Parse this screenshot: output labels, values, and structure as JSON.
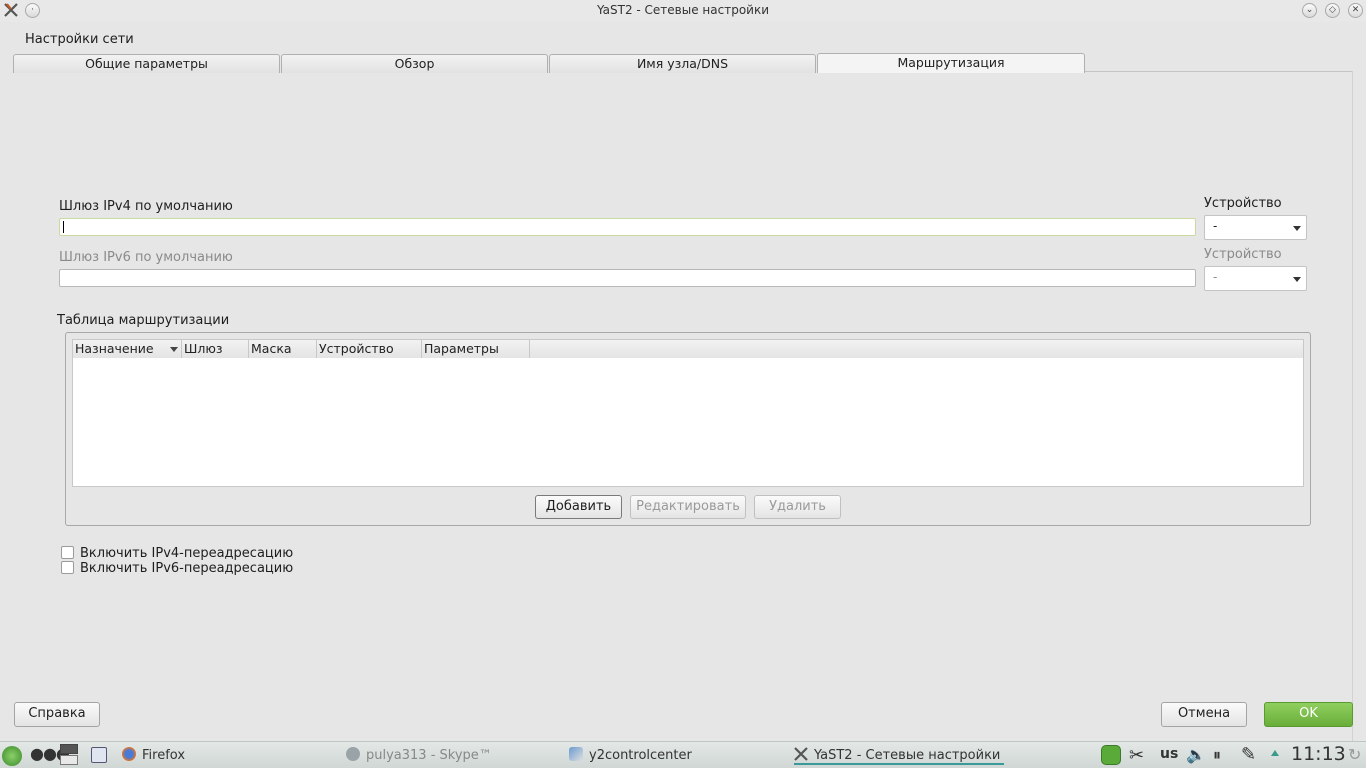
{
  "window": {
    "title": "YaST2 - Сетевые настройки"
  },
  "page": {
    "heading": "Настройки сети"
  },
  "tabs": [
    {
      "label": "Общие параметры"
    },
    {
      "label": "Обзор"
    },
    {
      "label": "Имя узла/DNS"
    },
    {
      "label": "Маршрутизация"
    }
  ],
  "ipv4": {
    "label": "Шлюз IPv4 по умолчанию",
    "value": "",
    "device_label": "Устройство",
    "device_value": "-"
  },
  "ipv6": {
    "label": "Шлюз IPv6 по умолчанию",
    "value": "",
    "device_label": "Устройство",
    "device_value": "-"
  },
  "routing_table": {
    "title": "Таблица маршрутизации",
    "columns": [
      "Назначение",
      "Шлюз",
      "Маска",
      "Устройство",
      "Параметры"
    ],
    "rows": []
  },
  "buttons": {
    "add": "Добавить",
    "edit": "Редактировать",
    "delete": "Удалить"
  },
  "checkboxes": [
    {
      "label": "Включить IPv4-переадресацию",
      "checked": false
    },
    {
      "label": "Включить IPv6-переадресацию",
      "checked": false
    }
  ],
  "footer": {
    "help": "Справка",
    "cancel": "Отмена",
    "ok": "OK"
  },
  "taskbar": {
    "tasks": [
      {
        "label": "Firefox"
      },
      {
        "label": "pulya313 - Skype™"
      },
      {
        "label": "y2controlcenter"
      },
      {
        "label": "YaST2 - Сетевые настройки"
      }
    ],
    "keyboard_layout": "us",
    "clock": "11:13"
  },
  "colors": {
    "ok_button": "#6aae3a",
    "background": "#e6e6e6",
    "focus_border": "#c8dca0"
  }
}
